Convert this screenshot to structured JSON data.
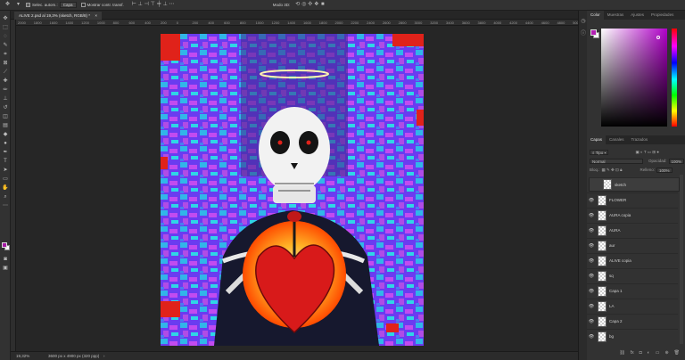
{
  "options_bar": {
    "auto_select_label": "Selec. autom.:",
    "auto_select_target": "Capa",
    "transform_label": "Mostrar contr. transf.",
    "mode_3d_label": "Modo 3D:"
  },
  "document": {
    "tab_title": "ALIVE 2.psd al 19,3% (sketch, RGB/8) *",
    "zoom": "19,32%",
    "dimensions": "3600 px x 4900 px (320 ppp)"
  },
  "ruler_ticks": [
    "2000",
    "1800",
    "1600",
    "1400",
    "1200",
    "1000",
    "800",
    "600",
    "400",
    "200",
    "0",
    "200",
    "400",
    "600",
    "800",
    "1000",
    "1200",
    "1400",
    "1600",
    "1800",
    "2000",
    "2200",
    "2400",
    "2600",
    "2800",
    "3000",
    "3200",
    "3400",
    "3600",
    "3800",
    "4000",
    "4200",
    "4400",
    "4600",
    "4800",
    "5000"
  ],
  "color_panel": {
    "tabs": [
      "Color",
      "Muestras",
      "Ajustes",
      "Propiedades"
    ],
    "active_tab": "Color",
    "foreground": "#b31fb3",
    "background": "#ffffff"
  },
  "layers_panel": {
    "tabs": [
      "Capas",
      "Canales",
      "Trazados"
    ],
    "active_tab": "Capas",
    "filter_label": "Tipo",
    "blend_mode": "Normal",
    "opacity_label": "Opacidad:",
    "opacity_value": "100%",
    "lock_label": "Bloq.:",
    "fill_label": "Relleno:",
    "fill_value": "100%",
    "layers": [
      {
        "name": "sketch",
        "visible": false,
        "selected": true
      },
      {
        "name": "FLOWER",
        "visible": true,
        "selected": false
      },
      {
        "name": "AURA copia",
        "visible": true,
        "selected": false
      },
      {
        "name": "AURA",
        "visible": true,
        "selected": false
      },
      {
        "name": "aur",
        "visible": true,
        "selected": false
      },
      {
        "name": "ALIVE copia",
        "visible": true,
        "selected": false
      },
      {
        "name": "sq",
        "visible": true,
        "selected": false
      },
      {
        "name": "Capa 1",
        "visible": true,
        "selected": false
      },
      {
        "name": "LA",
        "visible": true,
        "selected": false
      },
      {
        "name": "Capa 2",
        "visible": true,
        "selected": false
      },
      {
        "name": "bg",
        "visible": true,
        "selected": false
      }
    ]
  }
}
